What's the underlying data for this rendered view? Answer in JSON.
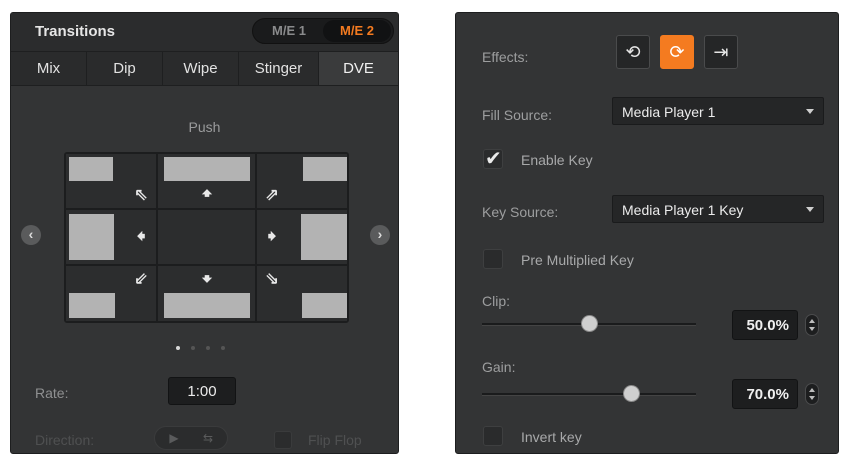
{
  "transitions": {
    "title": "Transitions",
    "me_buttons": [
      "M/E 1",
      "M/E 2"
    ],
    "selected_me": "M/E 2",
    "tabs": [
      "Mix",
      "Dip",
      "Wipe",
      "Stinger",
      "DVE"
    ],
    "active_tab": "DVE",
    "style_name": "Push",
    "page_dots": 4,
    "active_page": 1,
    "rate_label": "Rate:",
    "rate_value": "1:00",
    "direction_label": "Direction:",
    "flip_flop_label": "Flip Flop",
    "icons": {
      "prev": "chevron-left-icon",
      "next": "chevron-right-icon",
      "dir_normal": "play-icon",
      "dir_reverse": "loop-icon"
    }
  },
  "key": {
    "effects_label": "Effects:",
    "effects_buttons": [
      "rotate-ccw-icon",
      "rotate-cw-icon",
      "arrow-to-end-icon"
    ],
    "active_effect": "rotate-cw-icon",
    "fill_source_label": "Fill Source:",
    "fill_source_value": "Media Player 1",
    "enable_key_label": "Enable Key",
    "enable_key_checked": true,
    "key_source_label": "Key Source:",
    "key_source_value": "Media Player 1 Key",
    "pre_multiplied_label": "Pre Multiplied Key",
    "pre_multiplied_checked": false,
    "clip_label": "Clip:",
    "clip_value": "50.0%",
    "clip_level": 0.5,
    "gain_label": "Gain:",
    "gain_value": "70.0%",
    "gain_level": 0.7,
    "invert_label": "Invert key",
    "invert_checked": false
  },
  "colors": {
    "accent": "#f47b20",
    "panel_bg": "#333435"
  }
}
